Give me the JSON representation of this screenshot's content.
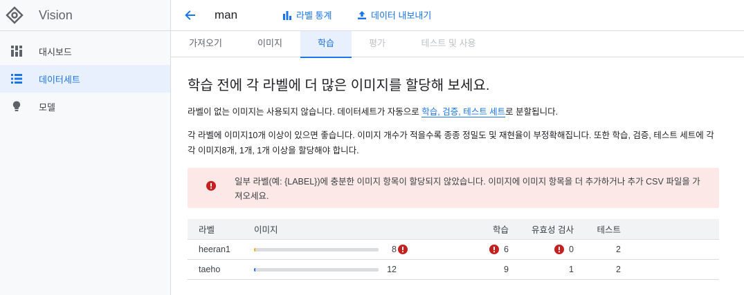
{
  "app": {
    "name": "Vision"
  },
  "sidebar": {
    "items": [
      {
        "label": "대시보드",
        "icon": "dashboard-icon",
        "active": false
      },
      {
        "label": "데이터세트",
        "icon": "list-icon",
        "active": true
      },
      {
        "label": "모델",
        "icon": "lightbulb-icon",
        "active": false
      }
    ]
  },
  "header": {
    "title": "man",
    "label_stats": "라벨 통계",
    "export_data": "데이터 내보내기"
  },
  "tabs": [
    {
      "label": "가져오기",
      "state": "normal"
    },
    {
      "label": "이미지",
      "state": "normal"
    },
    {
      "label": "학습",
      "state": "active"
    },
    {
      "label": "평가",
      "state": "disabled"
    },
    {
      "label": "테스트 및 사용",
      "state": "disabled"
    }
  ],
  "main": {
    "heading": "학습 전에 각 라벨에 더 많은 이미지를 할당해 보세요.",
    "para1_prefix": "라벨이 없는 이미지는 사용되지 않습니다. 데이터세트가 자동으로 ",
    "para1_link": "학습, 검증, 테스트 세트",
    "para1_suffix": "로 분할됩니다.",
    "para2": "각 라벨에 이미지10개 이상이 있으면 좋습니다. 이미지 개수가 적을수록 종종 정밀도 및 재현율이 부정확해집니다. 또한 학습, 검증, 테스트 세트에 각각 이미지8개, 1개, 1개 이상을 할당해야 합니다.",
    "alert": "일부 라벨(예: {LABEL})에 충분한 이미지 항목이 할당되지 않았습니다. 이미지에 이미지 항목을 더 추가하거나 추가 CSV 파일을 가져오세요."
  },
  "table": {
    "headers": {
      "label": "라벨",
      "images": "이미지",
      "train": "학습",
      "validation": "유효성 검사",
      "test": "테스트"
    },
    "rows": [
      {
        "label": "heeran1",
        "images": "8",
        "image_fraction": 0.013,
        "bar_color": "#f9ab00",
        "images_error": true,
        "train": "6",
        "train_error": true,
        "validation": "0",
        "validation_error": true,
        "test": "2"
      },
      {
        "label": "taeho",
        "images": "12",
        "image_fraction": 0.013,
        "bar_color": "#1a73e8",
        "images_error": false,
        "train": "9",
        "train_error": false,
        "validation": "1",
        "validation_error": false,
        "test": "2"
      }
    ]
  },
  "colors": {
    "accent": "#1a73e8",
    "error": "#d93025",
    "alert_bg": "#fce8e6",
    "warning": "#f9ab00"
  }
}
